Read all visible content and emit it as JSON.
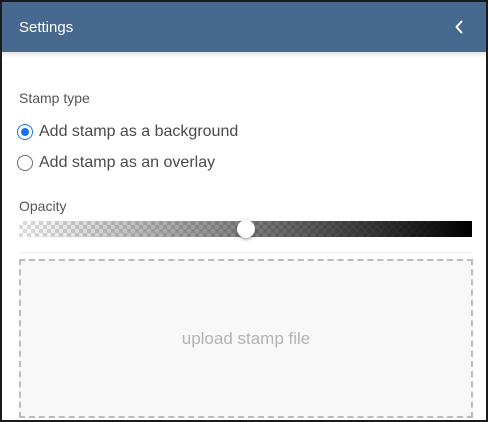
{
  "header": {
    "title": "Settings",
    "collapse_icon": "chevron-left-icon"
  },
  "stamp_type": {
    "label": "Stamp type",
    "options": [
      {
        "label": "Add stamp as a background",
        "checked": true
      },
      {
        "label": "Add stamp as an overlay",
        "checked": false
      }
    ]
  },
  "opacity": {
    "label": "Opacity",
    "value": 0.5
  },
  "upload": {
    "text": "upload stamp file"
  },
  "colors": {
    "header_bg": "#48698f",
    "accent": "#1a73e8"
  }
}
